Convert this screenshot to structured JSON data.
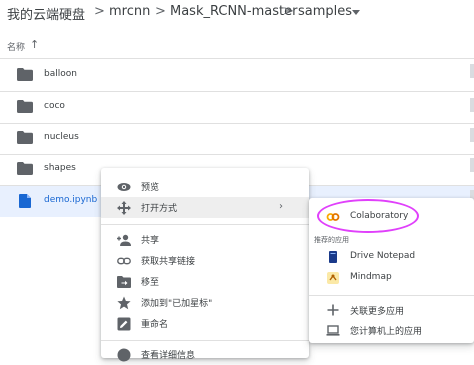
{
  "breadcrumb": {
    "items": [
      "我的云端硬盘",
      "mrcnn",
      "Mask_RCNN-master",
      "samples"
    ],
    "separator": ">"
  },
  "list_header": {
    "name_label": "名称",
    "sort_arrow": "↑"
  },
  "files": [
    {
      "name": "balloon",
      "type": "folder"
    },
    {
      "name": "coco",
      "type": "folder"
    },
    {
      "name": "nucleus",
      "type": "folder"
    },
    {
      "name": "shapes",
      "type": "folder"
    },
    {
      "name": "demo.ipynb",
      "type": "ipynb",
      "selected": true
    }
  ],
  "context_menu": {
    "preview": "预览",
    "open_with": "打开方式",
    "share": "共享",
    "get_link": "获取共享链接",
    "move_to": "移至",
    "add_star": "添加到\"已加星标\"",
    "rename": "重命名",
    "partial": "查看详细信息"
  },
  "submenu": {
    "colab": "Colaboratory",
    "recommended_header": "推荐的应用",
    "drive_notepad": "Drive Notepad",
    "mindmap": "Mindmap",
    "connect_more": "关联更多应用",
    "your_computer": "您计算机上的应用"
  },
  "colors": {
    "folder": "#5f6368",
    "selected_bg": "#e8f0fe",
    "selected_text": "#1967d2",
    "highlight_circle": "#e040fb",
    "colab_orange": "#f9ab00"
  }
}
